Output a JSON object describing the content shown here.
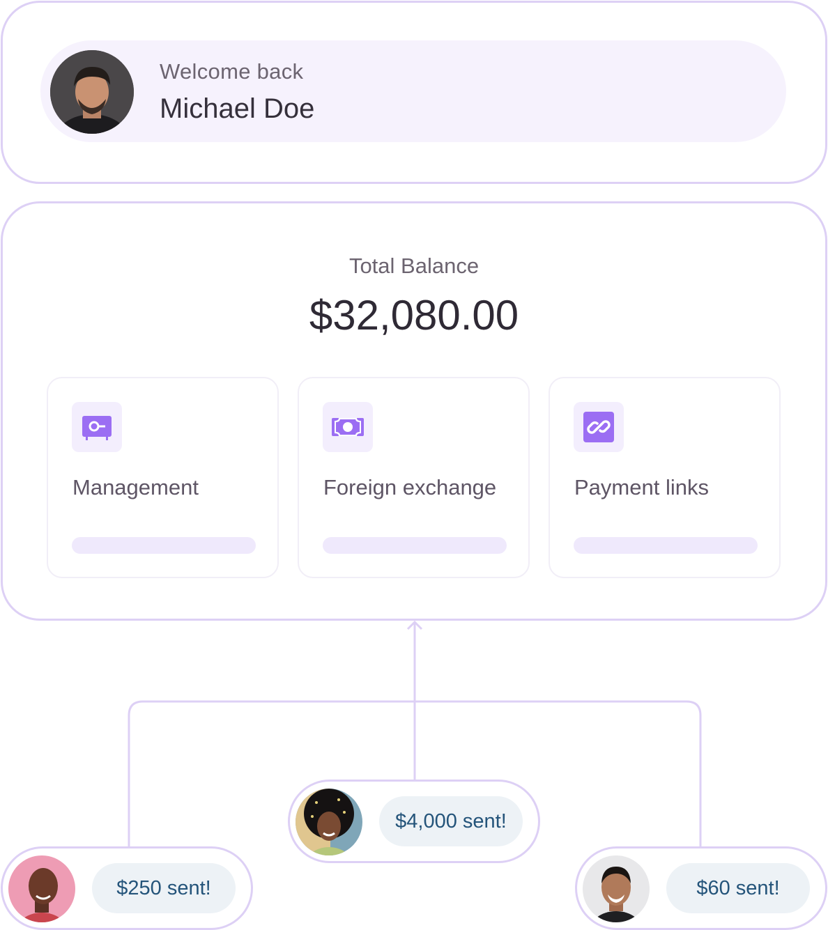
{
  "header": {
    "welcome_text": "Welcome back",
    "user_name": "Michael Doe"
  },
  "balance": {
    "label": "Total Balance",
    "amount": "$32,080.00"
  },
  "features": [
    {
      "label": "Management",
      "icon": "safe-icon"
    },
    {
      "label": "Foreign exchange",
      "icon": "banknote-icon"
    },
    {
      "label": "Payment links",
      "icon": "link-icon"
    }
  ],
  "transfers": {
    "center": "$4,000 sent!",
    "left": "$250 sent!",
    "right": "$60 sent!"
  },
  "colors": {
    "accent": "#9b6ef3",
    "border": "#ddd0f5",
    "pill_bg": "#f6f2fd",
    "sent_text": "#24547a"
  }
}
